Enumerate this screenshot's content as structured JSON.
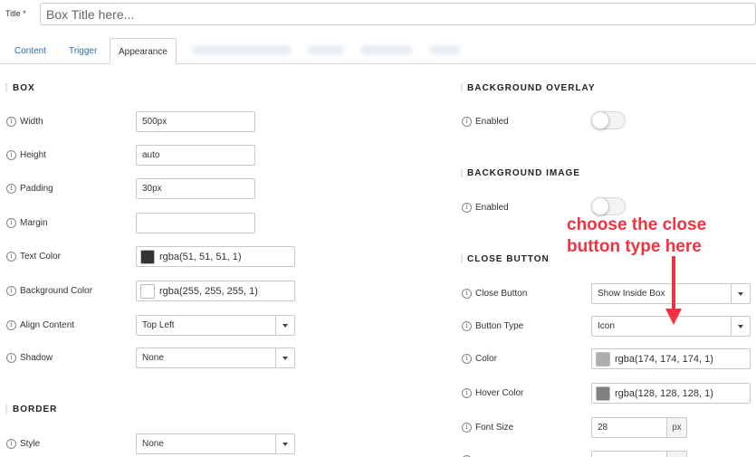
{
  "title": {
    "label": "Title",
    "required": "*",
    "value": "Box Title here..."
  },
  "tabs": [
    {
      "label": "Content"
    },
    {
      "label": "Trigger"
    },
    {
      "label": "Appearance"
    }
  ],
  "box": {
    "heading": "BOX",
    "width": {
      "label": "Width",
      "value": "500px"
    },
    "height": {
      "label": "Height",
      "value": "auto"
    },
    "padding": {
      "label": "Padding",
      "value": "30px"
    },
    "margin": {
      "label": "Margin",
      "value": ""
    },
    "text_color": {
      "label": "Text Color",
      "value": "rgba(51, 51, 51, 1)",
      "swatch": "#333333"
    },
    "background_color": {
      "label": "Background Color",
      "value": "rgba(255, 255, 255, 1)",
      "swatch": "#ffffff"
    },
    "align_content": {
      "label": "Align Content",
      "value": "Top Left"
    },
    "shadow": {
      "label": "Shadow",
      "value": "None"
    }
  },
  "border": {
    "heading": "BORDER",
    "style": {
      "label": "Style",
      "value": "None"
    }
  },
  "background_overlay": {
    "heading": "BACKGROUND OVERLAY",
    "enabled": {
      "label": "Enabled",
      "on": false
    }
  },
  "background_image": {
    "heading": "BACKGROUND IMAGE",
    "enabled": {
      "label": "Enabled",
      "on": false
    }
  },
  "close_button": {
    "heading": "CLOSE BUTTON",
    "close_button": {
      "label": "Close Button",
      "value": "Show Inside Box"
    },
    "button_type": {
      "label": "Button Type",
      "value": "Icon"
    },
    "color": {
      "label": "Color",
      "value": "rgba(174, 174, 174, 1)",
      "swatch": "#aeaeae"
    },
    "hover_color": {
      "label": "Hover Color",
      "value": "rgba(128, 128, 128, 1)",
      "swatch": "#808080"
    },
    "font_size": {
      "label": "Font Size",
      "value": "28",
      "unit": "px"
    }
  },
  "annotation": {
    "line1": "choose the close",
    "line2": "button type here",
    "color": "#ef3340"
  },
  "icons": {
    "info": "info-icon",
    "dropdown": "chevron-down-icon",
    "arrow": "arrow-down-icon"
  }
}
